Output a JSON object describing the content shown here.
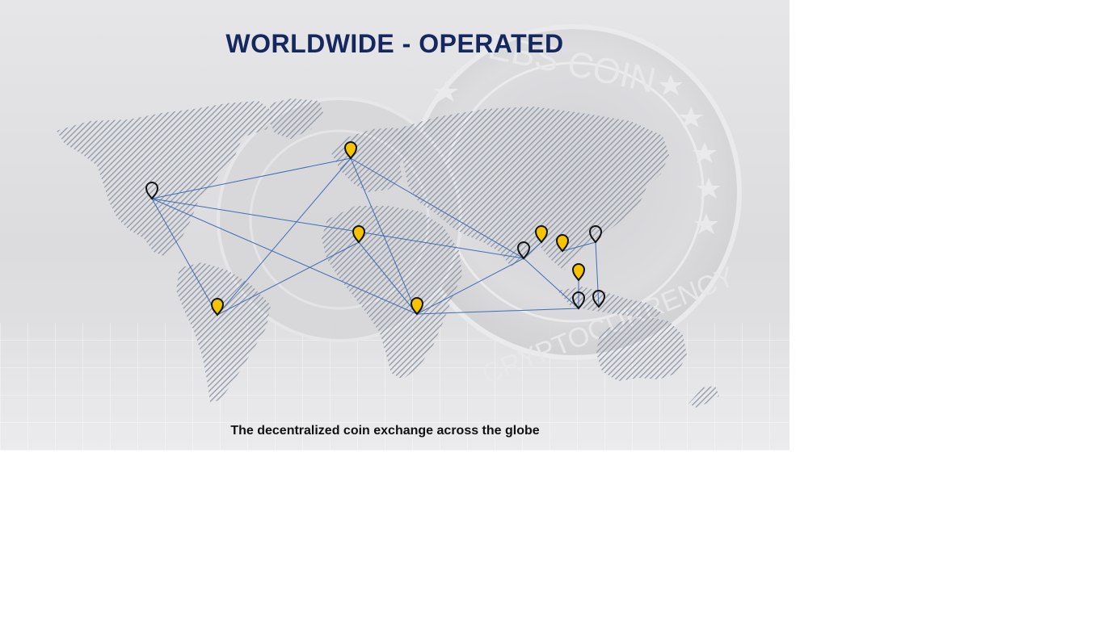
{
  "banner": {
    "title": "WORLDWIDE - OPERATED",
    "subtitle": "The decentralized coin exchange across the globe",
    "coin_text_top": "EBS COIN",
    "coin_text_bottom": "CRYPTOCURRENCY"
  },
  "colors": {
    "title": "#14275e",
    "route_line": "#3f6db5",
    "pin_gold": "#f5c400",
    "pin_outline": "#111111",
    "map_hatch": "#8e98a8"
  },
  "map": {
    "pins": [
      {
        "name": "north-america",
        "style": "outline"
      },
      {
        "name": "europe",
        "style": "gold"
      },
      {
        "name": "south-america",
        "style": "gold"
      },
      {
        "name": "north-africa",
        "style": "gold"
      },
      {
        "name": "south-africa",
        "style": "gold"
      },
      {
        "name": "india",
        "style": "outline"
      },
      {
        "name": "southeast-asia-1",
        "style": "gold"
      },
      {
        "name": "southeast-asia-2",
        "style": "gold"
      },
      {
        "name": "east-asia",
        "style": "outline"
      },
      {
        "name": "malaysia",
        "style": "gold"
      },
      {
        "name": "indonesia-west",
        "style": "outline"
      },
      {
        "name": "indonesia-east",
        "style": "outline"
      }
    ],
    "routes": [
      [
        "north-america",
        "europe"
      ],
      [
        "north-america",
        "south-america"
      ],
      [
        "north-america",
        "south-africa"
      ],
      [
        "north-america",
        "india"
      ],
      [
        "europe",
        "south-america"
      ],
      [
        "europe",
        "south-africa"
      ],
      [
        "europe",
        "india"
      ],
      [
        "north-africa",
        "south-america"
      ],
      [
        "north-africa",
        "south-africa"
      ],
      [
        "south-africa",
        "india"
      ],
      [
        "south-africa",
        "indonesia-west"
      ],
      [
        "india",
        "southeast-asia-1"
      ],
      [
        "india",
        "indonesia-west"
      ],
      [
        "southeast-asia-2",
        "east-asia"
      ],
      [
        "east-asia",
        "indonesia-east"
      ],
      [
        "malaysia",
        "indonesia-west"
      ]
    ]
  }
}
